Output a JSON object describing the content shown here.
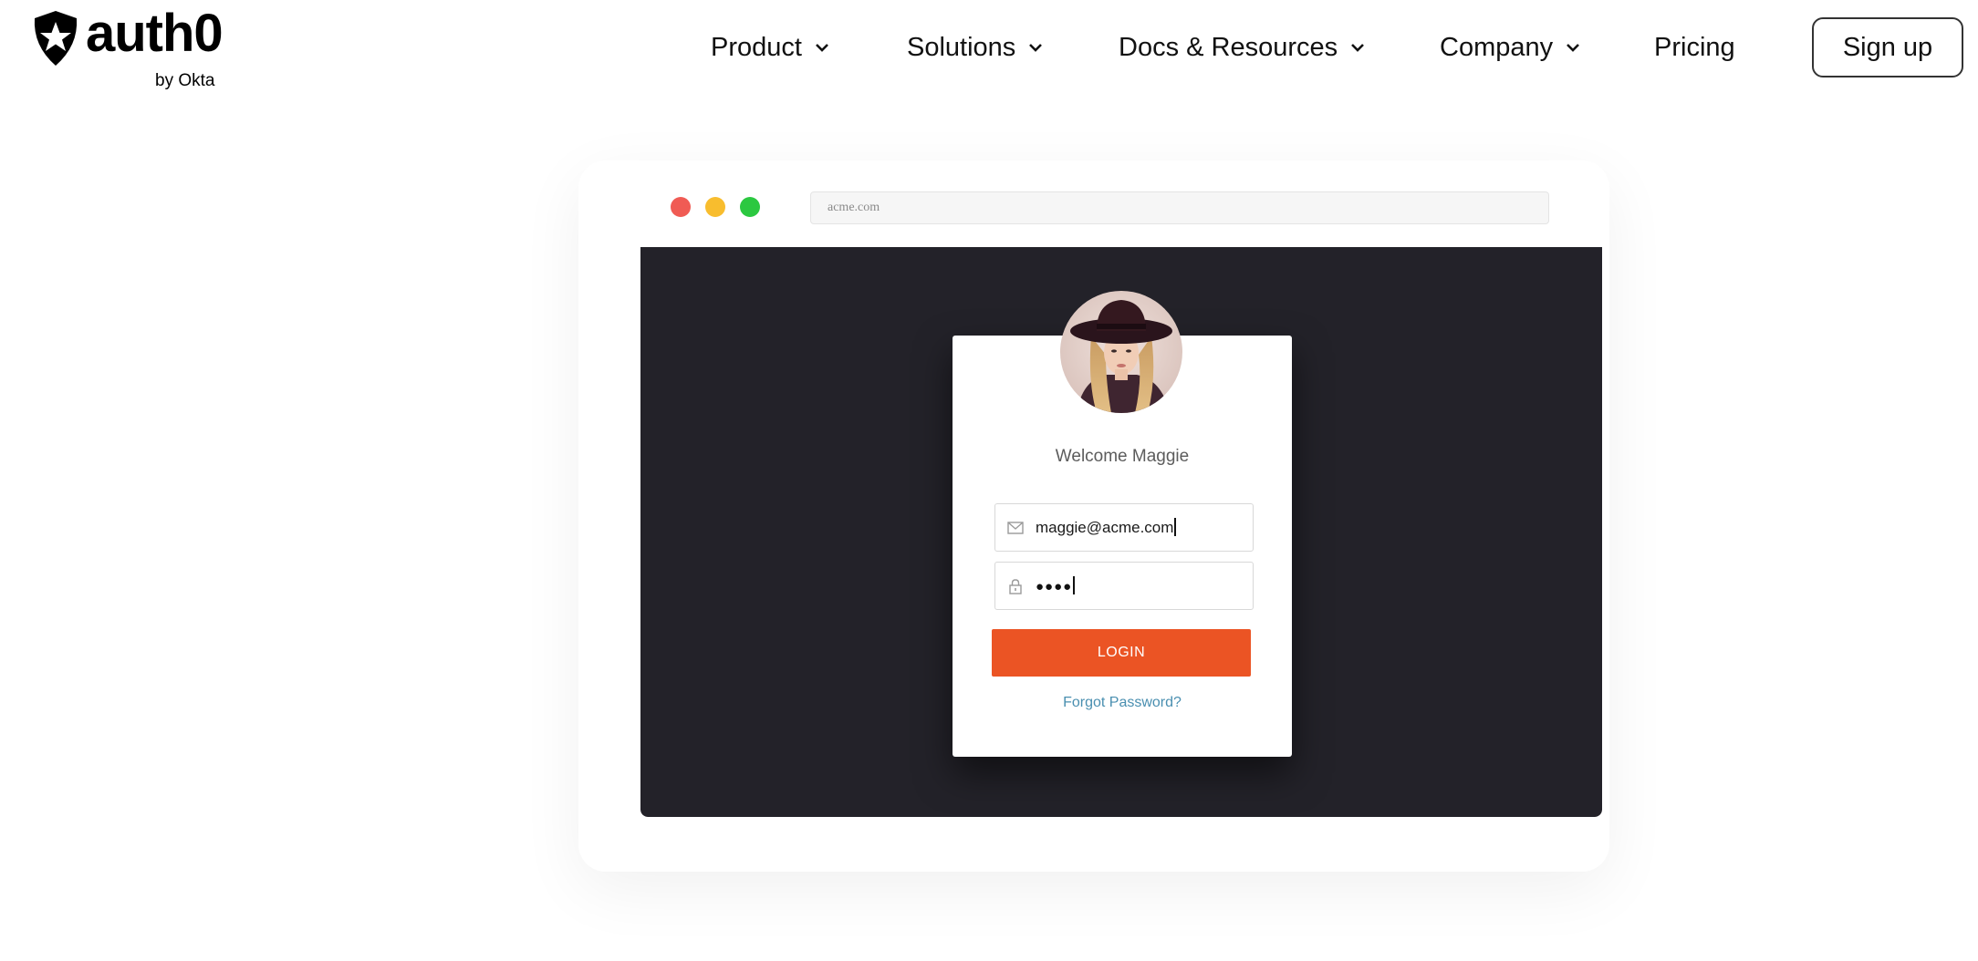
{
  "header": {
    "logo": {
      "wordmark": "auth0",
      "byline": "by Okta"
    },
    "nav": [
      {
        "label": "Product",
        "has_dropdown": true
      },
      {
        "label": "Solutions",
        "has_dropdown": true
      },
      {
        "label": "Docs & Resources",
        "has_dropdown": true
      },
      {
        "label": "Company",
        "has_dropdown": true
      },
      {
        "label": "Pricing",
        "has_dropdown": false
      }
    ],
    "signup_label": "Sign up"
  },
  "illustration": {
    "browser": {
      "address": "acme.com",
      "traffic_lights": {
        "close": "#f05b54",
        "minimize": "#f8bd2e",
        "maximize": "#2bc840"
      },
      "viewport_color": "#232229"
    },
    "login_card": {
      "welcome": "Welcome Maggie",
      "email_value": "maggie@acme.com",
      "email_icon": "envelope-icon",
      "password_value": "●●●●",
      "password_icon": "lock-icon",
      "login_label": "LOGIN",
      "login_color": "#eb5424",
      "forgot_label": "Forgot Password?"
    }
  }
}
